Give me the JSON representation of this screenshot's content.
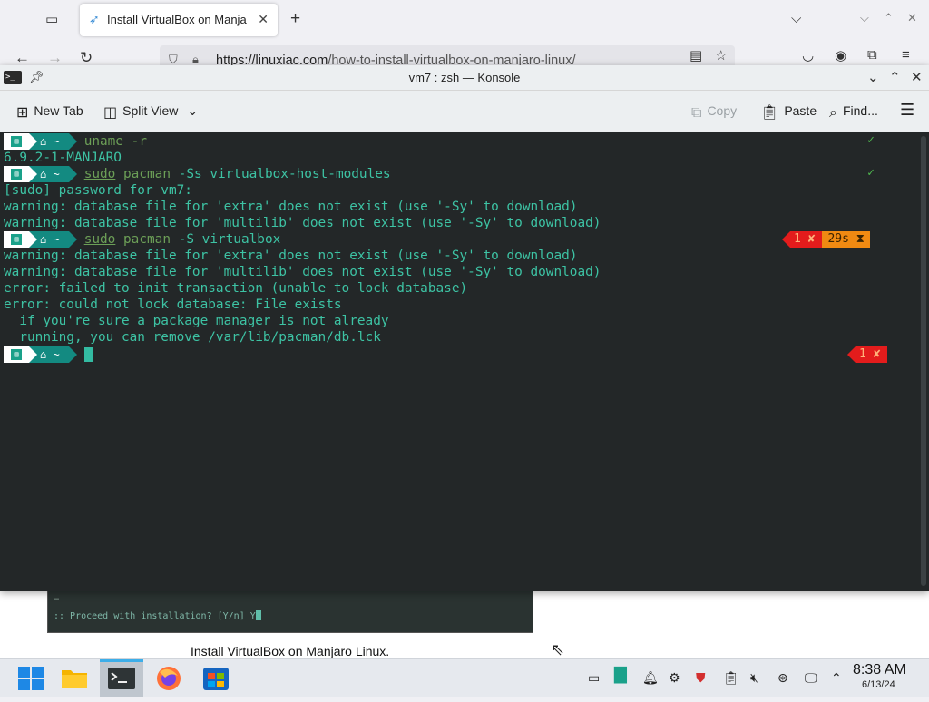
{
  "browser": {
    "tab_title": "Install VirtualBox on Manja",
    "url_domain": "https://linuxiac.com",
    "url_path": "/how-to-install-virtualbox-on-manjaro-linux/"
  },
  "page": {
    "image_line1": "…",
    "image_line2": ":: Proceed with installation? [Y/n] Y",
    "caption": "Install VirtualBox on Manjaro Linux."
  },
  "konsole": {
    "title": "vm7 : zsh — Konsole",
    "toolbar": {
      "new_tab": "New Tab",
      "split_view": "Split View",
      "copy": "Copy",
      "paste": "Paste",
      "find": "Find..."
    },
    "prompt_home": "~",
    "lines": {
      "cmd1": "uname -r",
      "out1": "6.9.2-1-MANJARO",
      "cmd2_sudo": "sudo",
      "cmd2_pacman": "pacman",
      "cmd2_args": " -Ss virtualbox-host-modules",
      "out2a": "[sudo] password for vm7:",
      "out2b": "warning: database file for 'extra' does not exist (use '-Sy' to download)",
      "out2c": "warning: database file for 'multilib' does not exist (use '-Sy' to download)",
      "cmd3_sudo": "sudo",
      "cmd3_pacman": "pacman",
      "cmd3_args": " -S virtualbox",
      "out3a": "warning: database file for 'extra' does not exist (use '-Sy' to download)",
      "out3b": "warning: database file for 'multilib' does not exist (use '-Sy' to download)",
      "out3c": "error: failed to init transaction (unable to lock database)",
      "out3d": "error: could not lock database: File exists",
      "out3e": "  if you're sure a package manager is not already",
      "out3f": "  running, you can remove /var/lib/pacman/db.lck"
    },
    "status": {
      "check": "✓",
      "err_code": "1 ✘",
      "duration": "29s ⧗"
    }
  },
  "taskbar": {
    "time": "8:38 AM",
    "date": "6/13/24"
  },
  "colors": {
    "terminal_bg": "#232728",
    "terminal_fg": "#3dc3a4",
    "prompt_teal": "#138a81",
    "error_red": "#e31c1c",
    "duration_orange": "#f08a12"
  }
}
